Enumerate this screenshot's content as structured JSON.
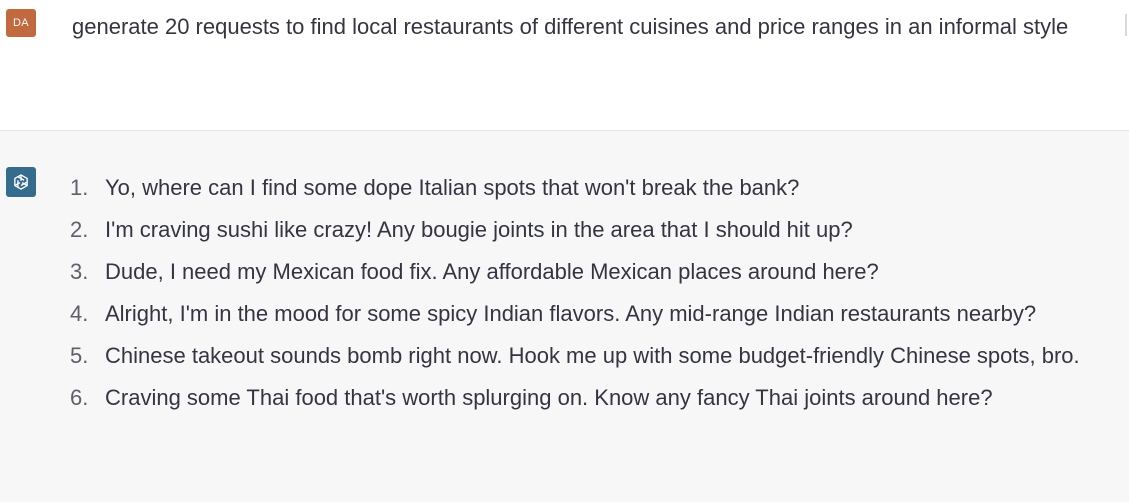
{
  "user": {
    "avatar_initials": "DA",
    "message": "generate 20 requests to find local restaurants of different cuisines and price ranges in an informal style"
  },
  "assistant": {
    "avatar_icon": "openai-logo-icon",
    "items": [
      {
        "num": "1.",
        "text": "Yo, where can I find some dope Italian spots that won't break the bank?"
      },
      {
        "num": "2.",
        "text": "I'm craving sushi like crazy! Any bougie joints in the area that I should hit up?"
      },
      {
        "num": "3.",
        "text": "Dude, I need my Mexican food fix. Any affordable Mexican places around here?"
      },
      {
        "num": "4.",
        "text": "Alright, I'm in the mood for some spicy Indian flavors. Any mid-range Indian restaurants nearby?"
      },
      {
        "num": "5.",
        "text": "Chinese takeout sounds bomb right now. Hook me up with some budget-friendly Chinese spots, bro."
      },
      {
        "num": "6.",
        "text": "Craving some Thai food that's worth splurging on. Know any fancy Thai joints around here?"
      }
    ]
  },
  "colors": {
    "user_avatar": "#c1693f",
    "assistant_avatar": "#356b8c",
    "assistant_bg": "#f7f7f8",
    "text": "#343541"
  }
}
